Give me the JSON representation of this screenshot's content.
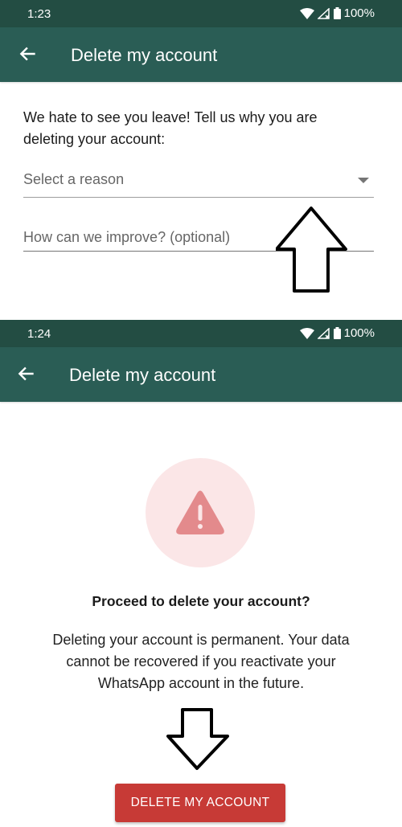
{
  "screens": [
    {
      "status_bar": {
        "time": "1:23",
        "battery": "100%",
        "icons": [
          "wifi-icon",
          "no-signal-icon",
          "battery-icon"
        ]
      },
      "app_bar": {
        "back_icon": "arrow-back-icon",
        "title": "Delete my account"
      },
      "intro_text": "We hate to see you leave! Tell us why you are deleting your account:",
      "reason_select": {
        "placeholder": "Select a reason",
        "icon": "dropdown-caret-icon"
      },
      "improve_field": {
        "placeholder": "How can we improve? (optional)",
        "value": ""
      },
      "annotation": "arrow-up-icon"
    },
    {
      "status_bar": {
        "time": "1:24",
        "battery": "100%",
        "icons": [
          "wifi-icon",
          "no-signal-icon",
          "battery-icon"
        ]
      },
      "app_bar": {
        "back_icon": "arrow-back-icon",
        "title": "Delete my account"
      },
      "warning_icon": "warning-triangle-icon",
      "heading": "Proceed to delete your account?",
      "body": "Deleting your account is permanent. Your data cannot be recovered if you reactivate your WhatsApp account in the future.",
      "delete_button": "DELETE MY ACCOUNT",
      "annotation": "arrow-down-icon"
    }
  ],
  "colors": {
    "status_bar": "#234d43",
    "app_bar": "#2a5d55",
    "danger": "#c73a36",
    "warning_bg": "#fbe6e7",
    "warning_icon": "#e38a8c"
  }
}
